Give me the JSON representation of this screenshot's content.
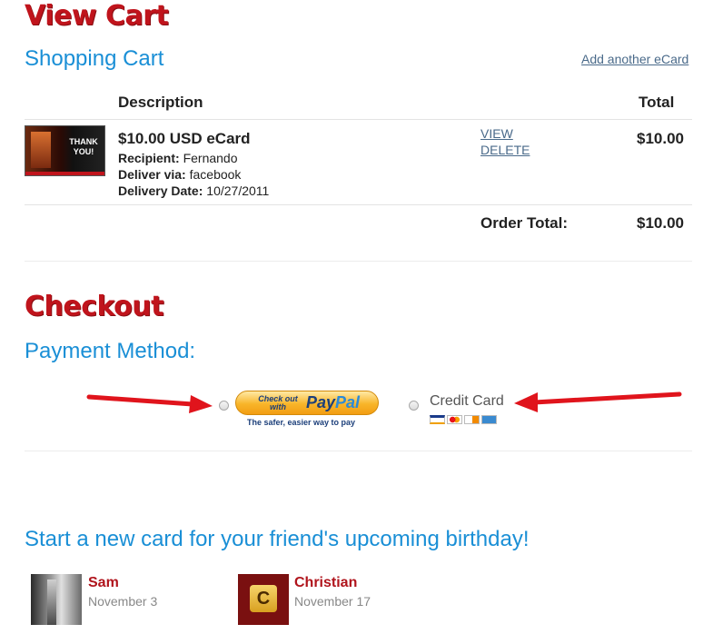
{
  "view_cart_title": "View Cart",
  "shopping_cart": {
    "heading": "Shopping Cart",
    "add_link": "Add another eCard",
    "col_description": "Description",
    "col_total": "Total",
    "item": {
      "thumb_text": "THANK YOU!",
      "name": "$10.00 USD eCard",
      "recipient_label": "Recipient:",
      "recipient_value": "Fernando",
      "deliver_label": "Deliver via:",
      "deliver_value": "facebook",
      "date_label": "Delivery Date:",
      "date_value": "10/27/2011",
      "view_link": "VIEW",
      "delete_link": "DELETE",
      "total": "$10.00"
    },
    "order_total_label": "Order Total:",
    "order_total_value": "$10.00"
  },
  "checkout_title": "Checkout",
  "payment": {
    "heading": "Payment Method:",
    "paypal_small": "Check out with",
    "paypal_pay": "Pay",
    "paypal_pal": "Pal",
    "paypal_tagline": "The safer, easier way to pay",
    "credit_label": "Credit Card",
    "card_logos": [
      "visa",
      "mastercard",
      "discover",
      "amex"
    ]
  },
  "birthday": {
    "heading": "Start a new card for your friend's upcoming birthday!",
    "friends": [
      {
        "name": "Sam",
        "date": "November 3"
      },
      {
        "name": "Christian",
        "date": "November 17"
      }
    ]
  },
  "colors": {
    "brand_red": "#c0141c",
    "heading_blue": "#1a8fd6",
    "arrow_red": "#e0141c",
    "friend_name": "#b0141c"
  }
}
